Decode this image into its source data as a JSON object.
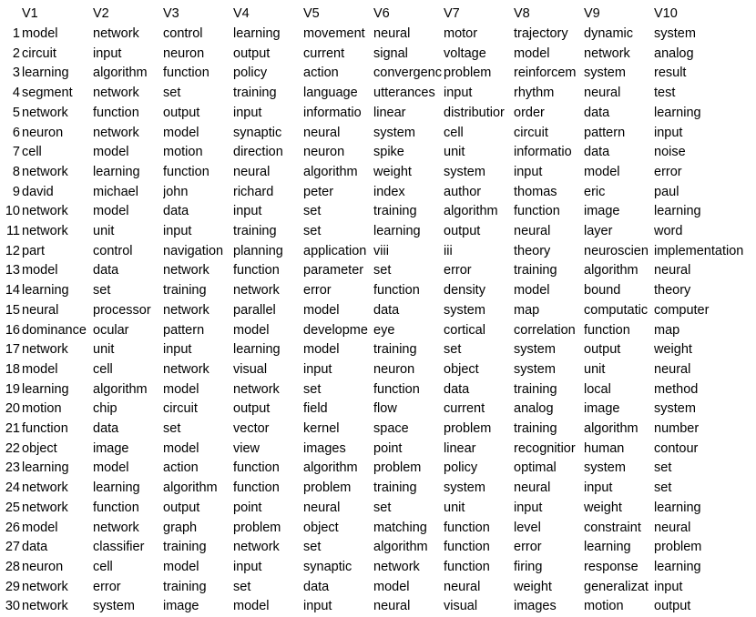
{
  "table": {
    "headers": [
      "V1",
      "V2",
      "V3",
      "V4",
      "V5",
      "V6",
      "V7",
      "V8",
      "V9",
      "V10"
    ],
    "rows": [
      {
        "index": "1",
        "cells": [
          "model",
          "network",
          "control",
          "learning",
          "movement",
          "neural",
          "motor",
          "trajectory",
          "dynamic",
          "system"
        ]
      },
      {
        "index": "2",
        "cells": [
          "circuit",
          "input",
          "neuron",
          "output",
          "current",
          "signal",
          "voltage",
          "model",
          "network",
          "analog"
        ]
      },
      {
        "index": "3",
        "cells": [
          "learning",
          "algorithm",
          "function",
          "policy",
          "action",
          "convergenc",
          "problem",
          "reinforcem",
          "system",
          "result"
        ]
      },
      {
        "index": "4",
        "cells": [
          "segment",
          "network",
          "set",
          "training",
          "language",
          "utterances",
          "input",
          "rhythm",
          "neural",
          "test"
        ]
      },
      {
        "index": "5",
        "cells": [
          "network",
          "function",
          "output",
          "input",
          "informatio",
          "linear",
          "distributior",
          "order",
          "data",
          "learning"
        ]
      },
      {
        "index": "6",
        "cells": [
          "neuron",
          "network",
          "model",
          "synaptic",
          "neural",
          "system",
          "cell",
          "circuit",
          "pattern",
          "input"
        ]
      },
      {
        "index": "7",
        "cells": [
          "cell",
          "model",
          "motion",
          "direction",
          "neuron",
          "spike",
          "unit",
          "informatio",
          "data",
          "noise"
        ]
      },
      {
        "index": "8",
        "cells": [
          "network",
          "learning",
          "function",
          "neural",
          "algorithm",
          "weight",
          "system",
          "input",
          "model",
          "error"
        ]
      },
      {
        "index": "9",
        "cells": [
          "david",
          "michael",
          "john",
          "richard",
          "peter",
          "index",
          "author",
          "thomas",
          "eric",
          "paul"
        ]
      },
      {
        "index": "10",
        "cells": [
          "network",
          "model",
          "data",
          "input",
          "set",
          "training",
          "algorithm",
          "function",
          "image",
          "learning"
        ]
      },
      {
        "index": "11",
        "cells": [
          "network",
          "unit",
          "input",
          "training",
          "set",
          "learning",
          "output",
          "neural",
          "layer",
          "word"
        ]
      },
      {
        "index": "12",
        "cells": [
          "part",
          "control",
          "navigation",
          "planning",
          "application",
          "viii",
          "iii",
          "theory",
          "neuroscien",
          "implementation"
        ]
      },
      {
        "index": "13",
        "cells": [
          "model",
          "data",
          "network",
          "function",
          "parameter",
          "set",
          "error",
          "training",
          "algorithm",
          "neural"
        ]
      },
      {
        "index": "14",
        "cells": [
          "learning",
          "set",
          "training",
          "network",
          "error",
          "function",
          "density",
          "model",
          "bound",
          "theory"
        ]
      },
      {
        "index": "15",
        "cells": [
          "neural",
          "processor",
          "network",
          "parallel",
          "model",
          "data",
          "system",
          "map",
          "computatic",
          "computer"
        ]
      },
      {
        "index": "16",
        "cells": [
          "dominance",
          "ocular",
          "pattern",
          "model",
          "developme",
          "eye",
          "cortical",
          "correlation",
          "function",
          "map"
        ]
      },
      {
        "index": "17",
        "cells": [
          "network",
          "unit",
          "input",
          "learning",
          "model",
          "training",
          "set",
          "system",
          "output",
          "weight"
        ]
      },
      {
        "index": "18",
        "cells": [
          "model",
          "cell",
          "network",
          "visual",
          "input",
          "neuron",
          "object",
          "system",
          "unit",
          "neural"
        ]
      },
      {
        "index": "19",
        "cells": [
          "learning",
          "algorithm",
          "model",
          "network",
          "set",
          "function",
          "data",
          "training",
          "local",
          "method"
        ]
      },
      {
        "index": "20",
        "cells": [
          "motion",
          "chip",
          "circuit",
          "output",
          "field",
          "flow",
          "current",
          "analog",
          "image",
          "system"
        ]
      },
      {
        "index": "21",
        "cells": [
          "function",
          "data",
          "set",
          "vector",
          "kernel",
          "space",
          "problem",
          "training",
          "algorithm",
          "number"
        ]
      },
      {
        "index": "22",
        "cells": [
          "object",
          "image",
          "model",
          "view",
          "images",
          "point",
          "linear",
          "recognitior",
          "human",
          "contour"
        ]
      },
      {
        "index": "23",
        "cells": [
          "learning",
          "model",
          "action",
          "function",
          "algorithm",
          "problem",
          "policy",
          "optimal",
          "system",
          "set"
        ]
      },
      {
        "index": "24",
        "cells": [
          "network",
          "learning",
          "algorithm",
          "function",
          "problem",
          "training",
          "system",
          "neural",
          "input",
          "set"
        ]
      },
      {
        "index": "25",
        "cells": [
          "network",
          "function",
          "output",
          "point",
          "neural",
          "set",
          "unit",
          "input",
          "weight",
          "learning"
        ]
      },
      {
        "index": "26",
        "cells": [
          "model",
          "network",
          "graph",
          "problem",
          "object",
          "matching",
          "function",
          "level",
          "constraint",
          "neural"
        ]
      },
      {
        "index": "27",
        "cells": [
          "data",
          "classifier",
          "training",
          "network",
          "set",
          "algorithm",
          "function",
          "error",
          "learning",
          "problem"
        ]
      },
      {
        "index": "28",
        "cells": [
          "neuron",
          "cell",
          "model",
          "input",
          "synaptic",
          "network",
          "function",
          "firing",
          "response",
          "learning"
        ]
      },
      {
        "index": "29",
        "cells": [
          "network",
          "error",
          "training",
          "set",
          "data",
          "model",
          "neural",
          "weight",
          "generalizat",
          "input"
        ]
      },
      {
        "index": "30",
        "cells": [
          "network",
          "system",
          "image",
          "model",
          "input",
          "neural",
          "visual",
          "images",
          "motion",
          "output"
        ]
      }
    ]
  }
}
